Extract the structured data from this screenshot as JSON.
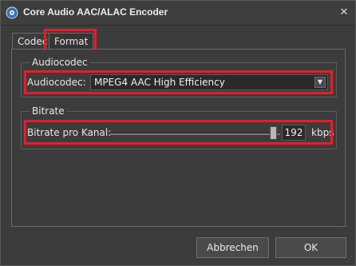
{
  "window": {
    "title": "Core Audio AAC/ALAC Encoder",
    "close_symbol": "✕",
    "app_icon": "audio-app-icon"
  },
  "tabs": [
    {
      "label": "Codec",
      "selected": true
    },
    {
      "label": "Format",
      "selected": false
    }
  ],
  "audiocodec_group": {
    "title": "Audiocodec",
    "field_label": "Audiocodec:",
    "selected_value": "MPEG4 AAC High Efficiency",
    "arrow": "▼"
  },
  "bitrate_group": {
    "title": "Bitrate",
    "field_label": "Bitrate pro Kanal:",
    "value": "192",
    "unit": "kbps",
    "slider_level": 0.96
  },
  "buttons": {
    "cancel": "Abbrechen",
    "ok": "OK"
  },
  "colors": {
    "highlight": "#e0202a",
    "background": "#3c3c3c"
  }
}
